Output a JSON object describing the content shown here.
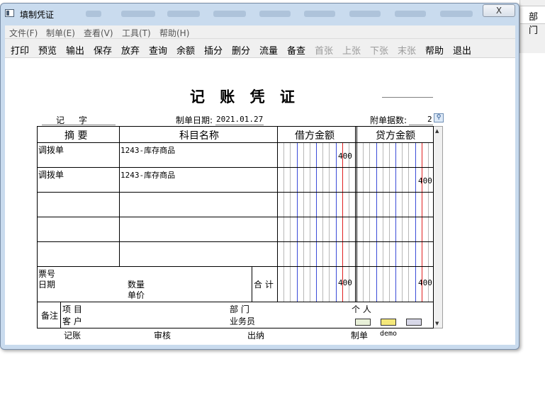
{
  "window": {
    "title": "填制凭证",
    "close_label": "X",
    "right_pane_text": "部门"
  },
  "menu": [
    "文件(F)",
    "制单(E)",
    "查看(V)",
    "工具(T)",
    "帮助(H)"
  ],
  "toolbar": [
    {
      "label": "打印",
      "enabled": true
    },
    {
      "label": "预览",
      "enabled": true
    },
    {
      "label": "输出",
      "enabled": true
    },
    {
      "label": "保存",
      "enabled": true
    },
    {
      "label": "放弃",
      "enabled": true
    },
    {
      "label": "查询",
      "enabled": true
    },
    {
      "label": "余额",
      "enabled": true
    },
    {
      "label": "插分",
      "enabled": true
    },
    {
      "label": "删分",
      "enabled": true
    },
    {
      "label": "流量",
      "enabled": true
    },
    {
      "label": "备查",
      "enabled": true
    },
    {
      "label": "首张",
      "enabled": false
    },
    {
      "label": "上张",
      "enabled": false
    },
    {
      "label": "下张",
      "enabled": false
    },
    {
      "label": "末张",
      "enabled": false
    },
    {
      "label": "帮助",
      "enabled": true
    },
    {
      "label": "退出",
      "enabled": true
    }
  ],
  "voucher": {
    "title": "记 账 凭 证",
    "type_label": "记",
    "no_label": "字",
    "date_label": "制单日期:",
    "date_value": "2021.01.27",
    "attach_label": "附单据数:",
    "attach_value": "2",
    "headers": {
      "summary": "摘 要",
      "account": "科目名称",
      "debit": "借方金额",
      "credit": "贷方金额"
    },
    "rows": [
      {
        "summary": "调拨单",
        "account": "1243-库存商品",
        "debit": "400",
        "credit": ""
      },
      {
        "summary": "调拨单",
        "account": "1243-库存商品",
        "debit": "",
        "credit": "400"
      },
      {
        "summary": "",
        "account": "",
        "debit": "",
        "credit": ""
      },
      {
        "summary": "",
        "account": "",
        "debit": "",
        "credit": ""
      },
      {
        "summary": "",
        "account": "",
        "debit": "",
        "credit": ""
      }
    ],
    "footer": {
      "ticket_no_label": "票号",
      "date_label": "日期",
      "quantity_label": "数量",
      "unit_price_label": "单价",
      "total_label": "合 计",
      "total_debit": "400",
      "total_credit": "400"
    },
    "remarks": {
      "label": "备注",
      "project_label": "项 目",
      "department_label": "部 门",
      "person_label": "个 人",
      "customer_label": "客 户",
      "salesman_label": "业务员"
    },
    "signatures": {
      "bookkeeper": "记账",
      "reviewer": "审核",
      "cashier": "出纳",
      "maker": "制单",
      "maker_name": "demo"
    }
  },
  "colors": {
    "window_frame": "#c9dbee",
    "digit_line_blue": "#3a4bd8",
    "digit_line_red": "#e02020",
    "digit_line_gray": "#b8b8b8"
  }
}
